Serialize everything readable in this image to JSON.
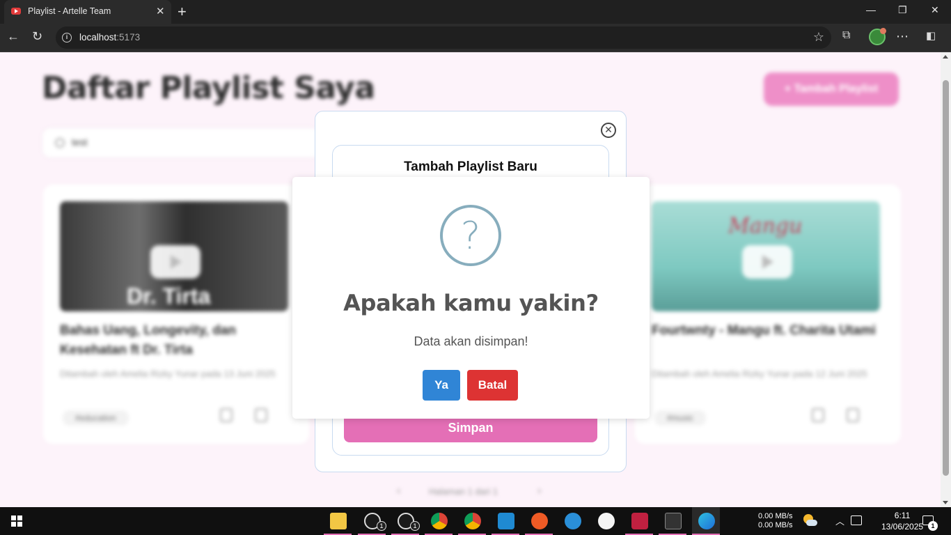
{
  "browser": {
    "tab_title": "Playlist - Artelle Team",
    "url_host": "localhost",
    "url_port": ":5173"
  },
  "page": {
    "title": "Daftar Playlist Saya",
    "add_button": "+ Tambah Playlist",
    "search_value": "test",
    "cards": [
      {
        "thumb_text": "Dr. Tirta",
        "title": "Bahas Uang, Longevity, dan Kesehatan ft Dr. Tirta",
        "meta": "Ditambah oleh Amelia Rizky Yunar pada 13 Juni 2025",
        "tag": "#education"
      },
      {
        "thumb_text": "Mangu",
        "title": "Fourtwnty - Mangu ft. Charita Utami",
        "meta": "Ditambah oleh Amelia Rizky Yunar pada 12 Juni 2025",
        "tag": "#music"
      }
    ],
    "pagination": "Halaman 1 dari 1"
  },
  "form_modal": {
    "title": "Tambah Playlist Baru",
    "save_button": "Simpan"
  },
  "confirm_dialog": {
    "icon": "?",
    "title": "Apakah kamu yakin?",
    "text": "Data akan disimpan!",
    "confirm_button": "Ya",
    "cancel_button": "Batal",
    "colors": {
      "confirm": "#3085d6",
      "cancel": "#dd3333",
      "icon": "#87adbd"
    }
  },
  "taskbar": {
    "whatsapp_badge_1": "1",
    "whatsapp_badge_2": "1",
    "net_up": "0.00 MB/s",
    "net_down": "0.00 MB/s",
    "time": "6:11",
    "date": "13/06/2025",
    "notification_count": "1"
  }
}
